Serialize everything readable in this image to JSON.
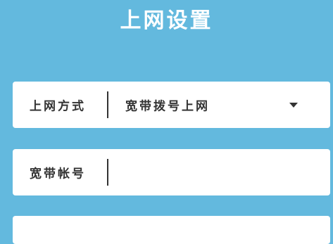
{
  "page": {
    "title": "上网设置"
  },
  "connection": {
    "label": "上网方式",
    "selected": "宽带拨号上网"
  },
  "account": {
    "label": "宽带帐号",
    "value": ""
  },
  "colors": {
    "background": "#63b9de",
    "panel": "#ffffff",
    "text": "#333333"
  },
  "icons": {
    "dropdown": "chevron-down-icon"
  }
}
